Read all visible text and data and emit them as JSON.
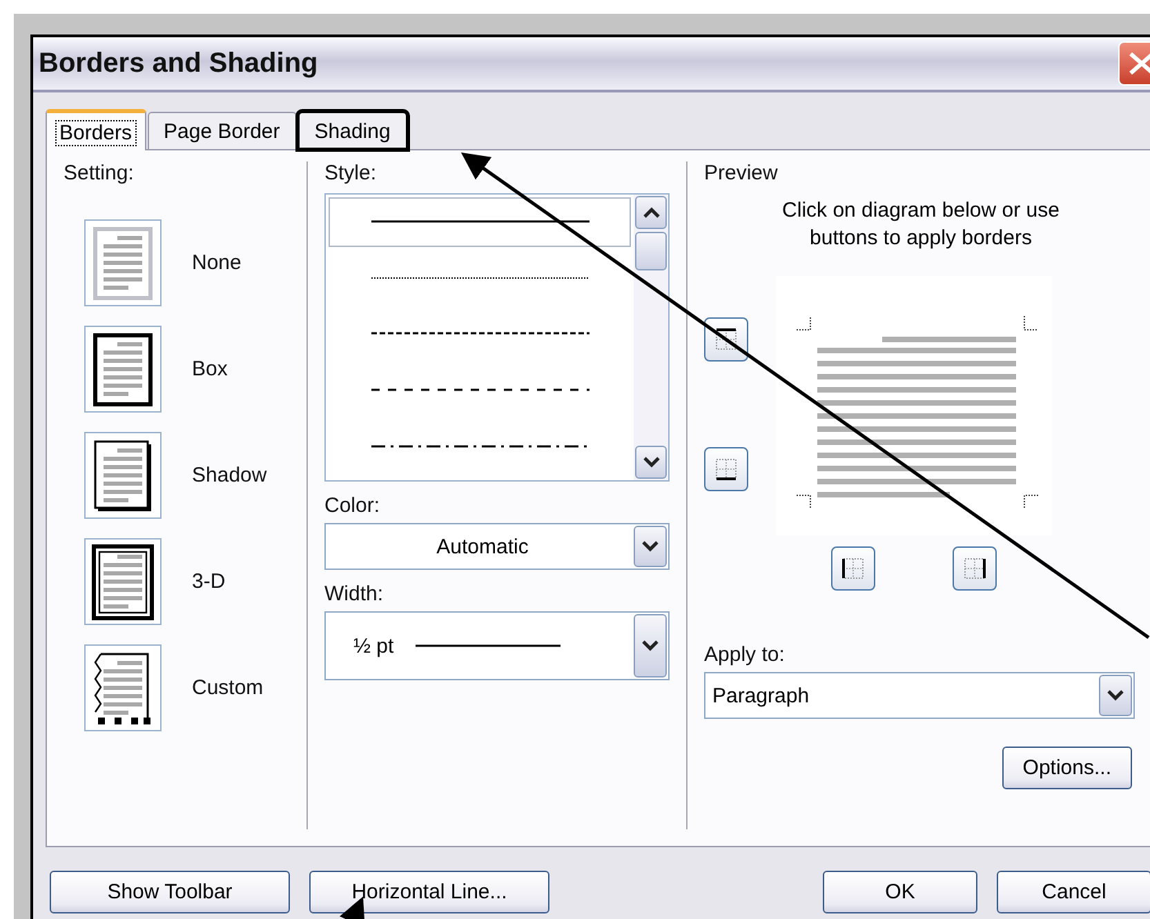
{
  "window": {
    "title": "Borders and Shading"
  },
  "tabs": [
    {
      "label": "Borders",
      "selected": true,
      "highlighted": false
    },
    {
      "label": "Page Border",
      "selected": false,
      "highlighted": false
    },
    {
      "label": "Shading",
      "selected": false,
      "highlighted": true
    }
  ],
  "setting": {
    "label": "Setting:",
    "options": [
      {
        "label": "None",
        "kind": "none"
      },
      {
        "label": "Box",
        "kind": "box"
      },
      {
        "label": "Shadow",
        "kind": "shadow"
      },
      {
        "label": "3-D",
        "kind": "threed"
      },
      {
        "label": "Custom",
        "kind": "custom"
      }
    ]
  },
  "style": {
    "label": "Style:",
    "lines": [
      {
        "kind": "solid",
        "selected": true
      },
      {
        "kind": "dotted",
        "selected": false
      },
      {
        "kind": "fine-dash",
        "selected": false
      },
      {
        "kind": "dash",
        "selected": false
      },
      {
        "kind": "dash-dot",
        "selected": false
      }
    ]
  },
  "color": {
    "label": "Color:",
    "value": "Automatic"
  },
  "width": {
    "label": "Width:",
    "value": "½ pt"
  },
  "preview": {
    "label": "Preview",
    "hint": "Click on diagram below or use buttons to apply borders"
  },
  "apply_to": {
    "label": "Apply to:",
    "value": "Paragraph"
  },
  "options_button": "Options...",
  "footer_buttons": [
    {
      "label": "Show Toolbar",
      "kind": "left"
    },
    {
      "label": "Horizontal Line...",
      "kind": "left"
    },
    {
      "label": "OK",
      "kind": "right"
    },
    {
      "label": "Cancel",
      "kind": "right"
    }
  ]
}
